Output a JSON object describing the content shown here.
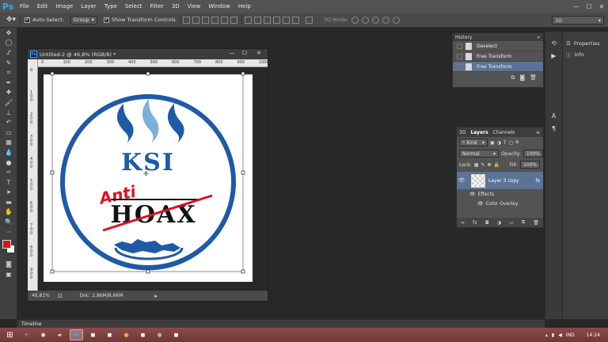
{
  "menubar": {
    "items": [
      "File",
      "Edit",
      "Image",
      "Layer",
      "Type",
      "Select",
      "Filter",
      "3D",
      "View",
      "Window",
      "Help"
    ],
    "logo": "Ps"
  },
  "options": {
    "auto_select_label": "Auto-Select:",
    "auto_select_value": "Group",
    "show_transform_label": "Show Transform Controls",
    "mode_3d_label": "3D Mode:",
    "workspace_value": "3D"
  },
  "document": {
    "tab_title": "Untitled-2 @ 46,8% (RGB/8) *",
    "ruler_top": [
      "0",
      "100",
      "200",
      "300",
      "400",
      "500",
      "600",
      "700",
      "800",
      "900",
      "1000"
    ],
    "ruler_left": [
      "0",
      "1\n0\n0",
      "2\n0\n0",
      "3\n0\n0",
      "4\n0\n0",
      "5\n0\n0",
      "6\n0\n0",
      "7\n0\n0",
      "8\n0\n0",
      "9\n0\n0"
    ],
    "zoom": "46,81%",
    "doc_info": "Doc: 2,86M/8,66M"
  },
  "artwork": {
    "ksi": "KSI",
    "anti": "Anti",
    "hoax": "HOAX",
    "blue": "#1f5aa6",
    "red": "#e0101e"
  },
  "history": {
    "tab": "History",
    "items": [
      {
        "label": "Deselect",
        "active": false
      },
      {
        "label": "Free Transform",
        "active": false
      },
      {
        "label": "Free Transform",
        "active": true
      }
    ]
  },
  "properties": {
    "items": [
      "Properties",
      "Info"
    ]
  },
  "layers": {
    "tabs": [
      "3D",
      "Layers",
      "Channels"
    ],
    "filter_label": "Kind",
    "blend_mode": "Normal",
    "opacity_label": "Opacity:",
    "opacity_value": "100%",
    "lock_label": "Lock:",
    "fill_label": "Fill:",
    "fill_value": "100%",
    "layer_name": "Layer 3 copy",
    "effects_label": "Effects",
    "color_overlay_label": "Color Overlay",
    "fx": "fx"
  },
  "timeline": {
    "label": "Timeline"
  },
  "taskbar": {
    "lang": "IND",
    "time": "14:24"
  }
}
